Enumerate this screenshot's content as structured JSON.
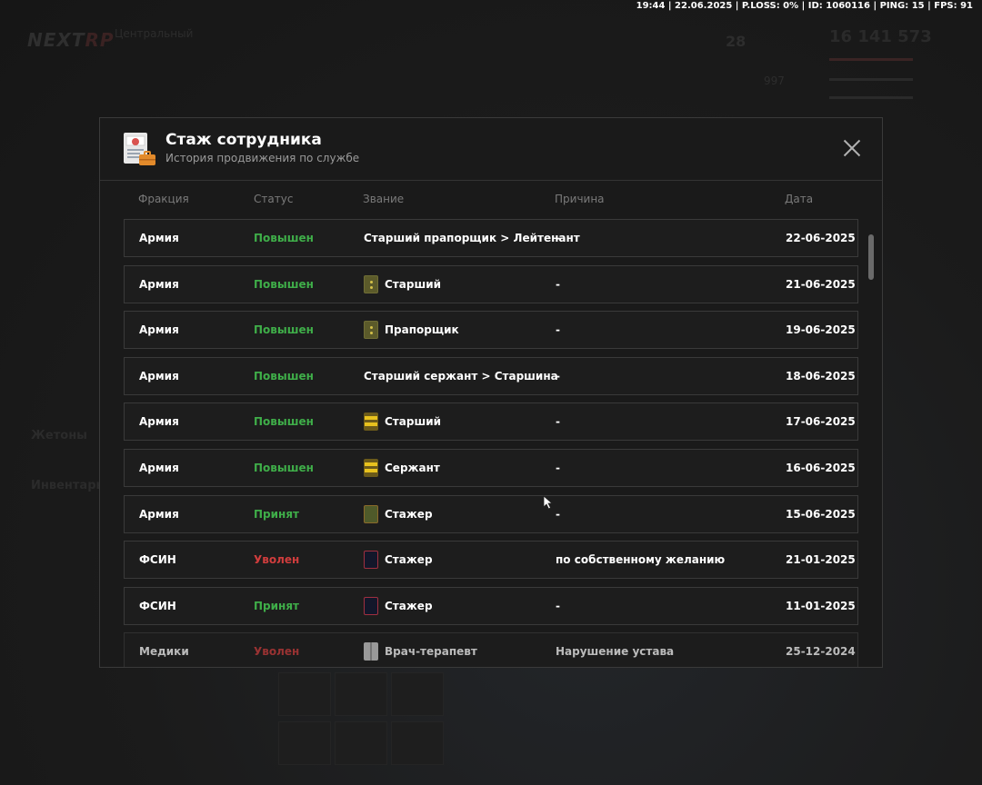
{
  "status_bar": {
    "text": "19:44 | 22.06.2025 | P.LOSS: 0% | ID: 1060116 | PING: 15 | FPS: 91"
  },
  "background": {
    "logo_a": "NEXT",
    "logo_b": "RP",
    "server": "Центральный",
    "money": "16 141 573",
    "stat_1": "28",
    "stat_2": "997",
    "side_1": "Жетоны",
    "side_2": "Инвентарь"
  },
  "modal": {
    "title": "Стаж сотрудника",
    "subtitle": "История продвижения по службе",
    "icon": "document-briefcase-icon",
    "close_icon": "close-icon"
  },
  "table": {
    "headers": {
      "faction": "Фракция",
      "status": "Статус",
      "rank": "Звание",
      "reason": "Причина",
      "date": "Дата"
    },
    "rows": [
      {
        "faction": "Армия",
        "status": "Повышен",
        "status_color": "#3fae49",
        "rank": "Старший прапорщик > Лейтенант",
        "rank_icon": "none",
        "reason": "-",
        "date": "22-06-2025"
      },
      {
        "faction": "Армия",
        "status": "Повышен",
        "status_color": "#3fae49",
        "rank": "Старший",
        "rank_icon": "olive-shoulder-strap-icon",
        "reason": "-",
        "date": "21-06-2025"
      },
      {
        "faction": "Армия",
        "status": "Повышен",
        "status_color": "#3fae49",
        "rank": "Прапорщик",
        "rank_icon": "olive-shoulder-strap-icon",
        "reason": "-",
        "date": "19-06-2025"
      },
      {
        "faction": "Армия",
        "status": "Повышен",
        "status_color": "#3fae49",
        "rank": "Старший сержант > Старшина",
        "rank_icon": "none",
        "reason": "-",
        "date": "18-06-2025"
      },
      {
        "faction": "Армия",
        "status": "Повышен",
        "status_color": "#3fae49",
        "rank": "Старший",
        "rank_icon": "gold-stripes-icon",
        "reason": "-",
        "date": "17-06-2025"
      },
      {
        "faction": "Армия",
        "status": "Повышен",
        "status_color": "#3fae49",
        "rank": "Сержант",
        "rank_icon": "gold-stripes-icon",
        "reason": "-",
        "date": "16-06-2025"
      },
      {
        "faction": "Армия",
        "status": "Принят",
        "status_color": "#3fae49",
        "rank": "Стажер",
        "rank_icon": "green-trainee-strap-icon",
        "reason": "-",
        "date": "15-06-2025"
      },
      {
        "faction": "ФСИН",
        "status": "Уволен",
        "status_color": "#d03d3d",
        "rank": "Стажер",
        "rank_icon": "navy-strap-icon",
        "reason": "по собственному желанию",
        "date": "21-01-2025"
      },
      {
        "faction": "ФСИН",
        "status": "Принят",
        "status_color": "#3fae49",
        "rank": "Стажер",
        "rank_icon": "navy-strap-icon",
        "reason": "-",
        "date": "11-01-2025"
      },
      {
        "faction": "Медики",
        "status": "Уволен",
        "status_color": "#d03d3d",
        "rank": "Врач-терапевт",
        "rank_icon": "white-coat-strap-icon",
        "reason": "Нарушение устава",
        "date": "25-12-2024"
      }
    ]
  }
}
